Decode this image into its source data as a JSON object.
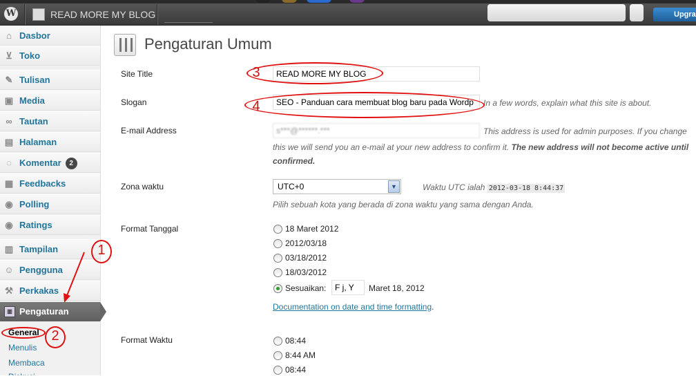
{
  "adminbar": {
    "site_name": "READ MORE MY BLOG",
    "upgrade_label": "Upgra",
    "wp_logo": "wordpress-logo"
  },
  "sidebar": {
    "items": [
      {
        "label": "Dasbor",
        "icon": "home-icon"
      },
      {
        "label": "Toko",
        "icon": "cart-icon"
      },
      {
        "label": "Tulisan",
        "icon": "pin-icon"
      },
      {
        "label": "Media",
        "icon": "media-icon"
      },
      {
        "label": "Tautan",
        "icon": "link-icon"
      },
      {
        "label": "Halaman",
        "icon": "page-icon"
      },
      {
        "label": "Komentar",
        "icon": "comment-icon",
        "badge": "2"
      },
      {
        "label": "Feedbacks",
        "icon": "feedback-icon"
      },
      {
        "label": "Polling",
        "icon": "poll-icon"
      },
      {
        "label": "Ratings",
        "icon": "ratings-icon"
      },
      {
        "label": "Tampilan",
        "icon": "appearance-icon"
      },
      {
        "label": "Pengguna",
        "icon": "users-icon"
      },
      {
        "label": "Perkakas",
        "icon": "tools-icon"
      },
      {
        "label": "Pengaturan",
        "icon": "settings-icon"
      }
    ],
    "submenu": [
      "General",
      "Menulis",
      "Membaca"
    ]
  },
  "page": {
    "title": "Pengaturan Umum"
  },
  "form": {
    "site_title_label": "Site Title",
    "site_title_value": "READ MORE MY BLOG",
    "slogan_label": "Slogan",
    "slogan_value": "SEO - Panduan cara membuat blog baru pada Wordp",
    "slogan_desc": "In a few words, explain what this site is about.",
    "email_label": "E-mail Address",
    "email_value": "s***@******.***",
    "email_desc_1": "This address is used for admin purposes. If you change",
    "email_desc_2": "this we will send you an e-mail at your new address to confirm it.",
    "email_desc_bold": "The new address will not become active until",
    "email_desc_3": "confirmed.",
    "timezone_label": "Zona waktu",
    "timezone_value": "UTC+0",
    "utc_text": "Waktu UTC ialah",
    "utc_time": "2012-03-18 8:44:37",
    "timezone_desc": "Pilih sebuah kota yang berada di zona waktu yang sama dengan Anda.",
    "date_format_label": "Format Tanggal",
    "date_options": [
      "18 Maret 2012",
      "2012/03/18",
      "03/18/2012",
      "18/03/2012"
    ],
    "custom_label": "Sesuaikan:",
    "custom_value": "F j, Y",
    "custom_preview": "Maret 18, 2012",
    "doc_link": "Documentation on date and time formatting",
    "doc_link_suffix": ".",
    "time_format_label": "Format Waktu",
    "time_options": [
      "08:44",
      "8:44 AM",
      "08:44"
    ]
  },
  "annotations": [
    "1",
    "2",
    "3",
    "4"
  ],
  "colors": {
    "link": "#21759b",
    "annotation": "#e01010",
    "adminbar": "#464646",
    "active_menu": "#6d6d6d"
  }
}
